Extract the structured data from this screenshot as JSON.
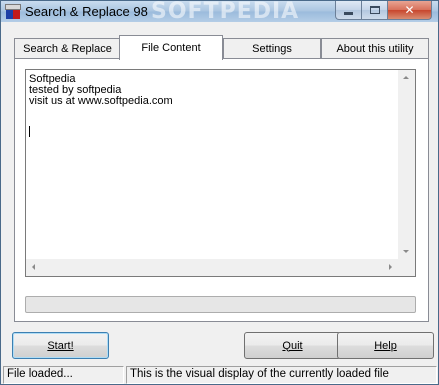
{
  "window": {
    "title": "Search & Replace 98",
    "watermark": "SOFTPEDIA"
  },
  "tabs": [
    {
      "label": "Search & Replace",
      "active": false
    },
    {
      "label": "File Content",
      "active": true
    },
    {
      "label": "Settings",
      "active": false
    },
    {
      "label": "About this utility",
      "active": false
    }
  ],
  "file_content": {
    "lines": [
      "Softpedia",
      "tested by softpedia",
      "visit us at www.softpedia.com"
    ]
  },
  "buttons": {
    "start": "Start!",
    "quit": "Quit",
    "help": "Help"
  },
  "status": {
    "left": "File loaded...",
    "right": "This is the visual display of the currently loaded file"
  },
  "icons": {
    "app": "app-icon",
    "minimize": "minimize-icon",
    "maximize": "maximize-icon",
    "close": "close-icon"
  },
  "colors": {
    "titlebar": "#a9c4e0",
    "close_button": "#c7462d",
    "default_button_border": "#3c7fb1"
  }
}
